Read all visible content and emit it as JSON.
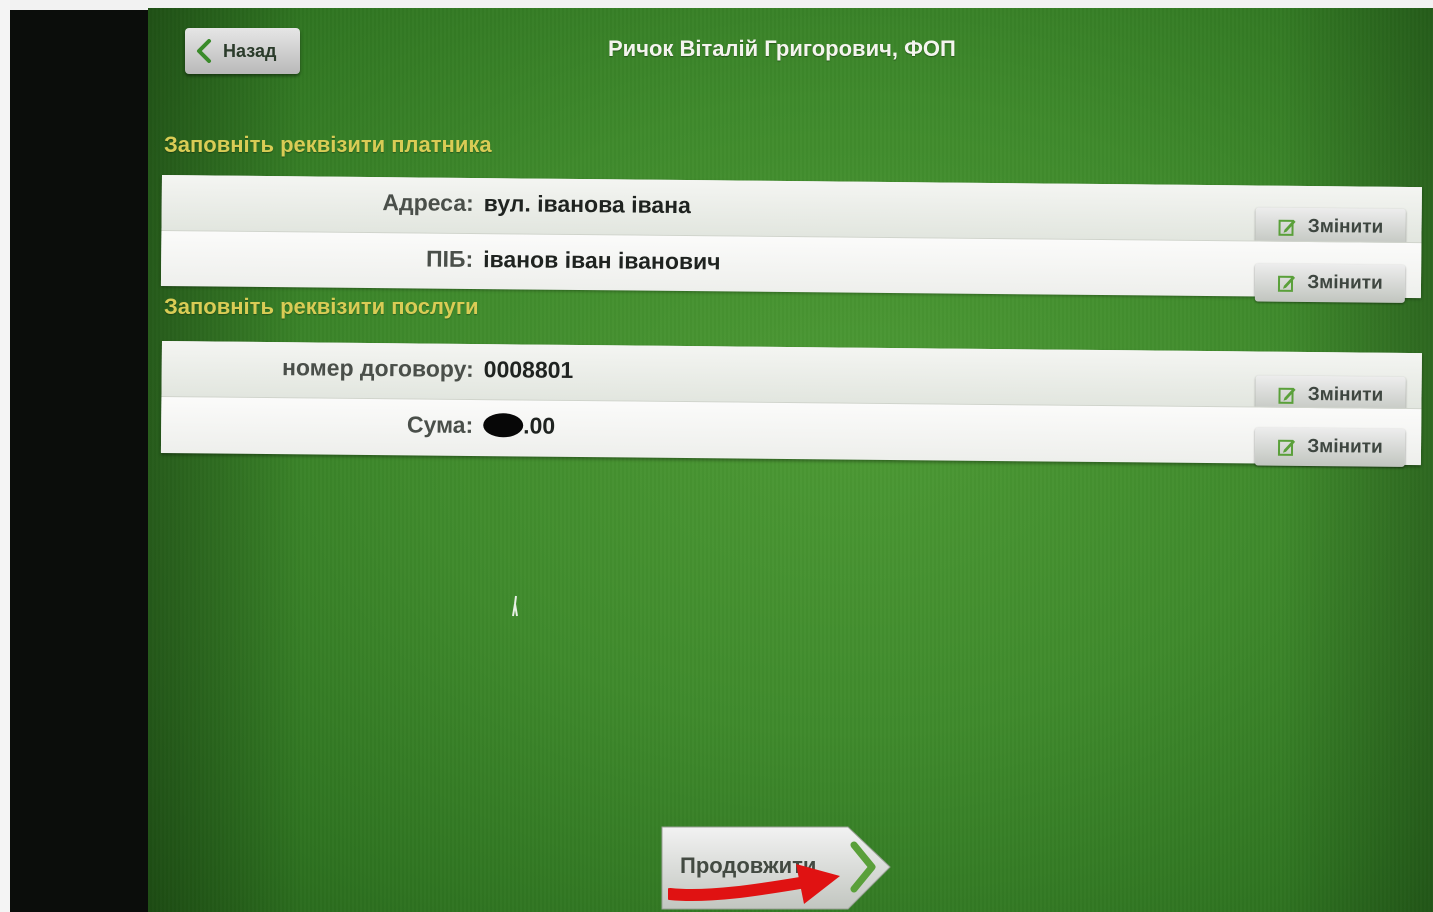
{
  "header": {
    "back_label": "Назад",
    "title": "Ричок Віталій Григорович, ФОП"
  },
  "payer_section": {
    "title": "Заповніть реквізити платника",
    "rows": [
      {
        "label": "Адреса:",
        "value": "вул. іванова івана",
        "edit_label": "Змінити"
      },
      {
        "label": "ПІБ:",
        "value": "іванов іван іванович",
        "edit_label": "Змінити"
      }
    ]
  },
  "service_section": {
    "title": "Заповніть реквізити послуги",
    "rows": [
      {
        "label": "номер договору:",
        "value": "0008801",
        "edit_label": "Змінити"
      },
      {
        "label": "Сума:",
        "value": ".00",
        "edit_label": "Змінити"
      }
    ]
  },
  "footer": {
    "continue_label": "Продовжити"
  },
  "colors": {
    "screen_green": "#3f8a2c",
    "section_title": "#d9cc55",
    "panel_bg": "#eef0ec",
    "button_gray": "#c1c5bf",
    "annotation_red": "#e01212"
  },
  "icons": {
    "back": "chevron-left-icon",
    "edit": "edit-pencil-icon",
    "continue": "chevron-right-icon",
    "annotation": "red-arrow-icon"
  }
}
